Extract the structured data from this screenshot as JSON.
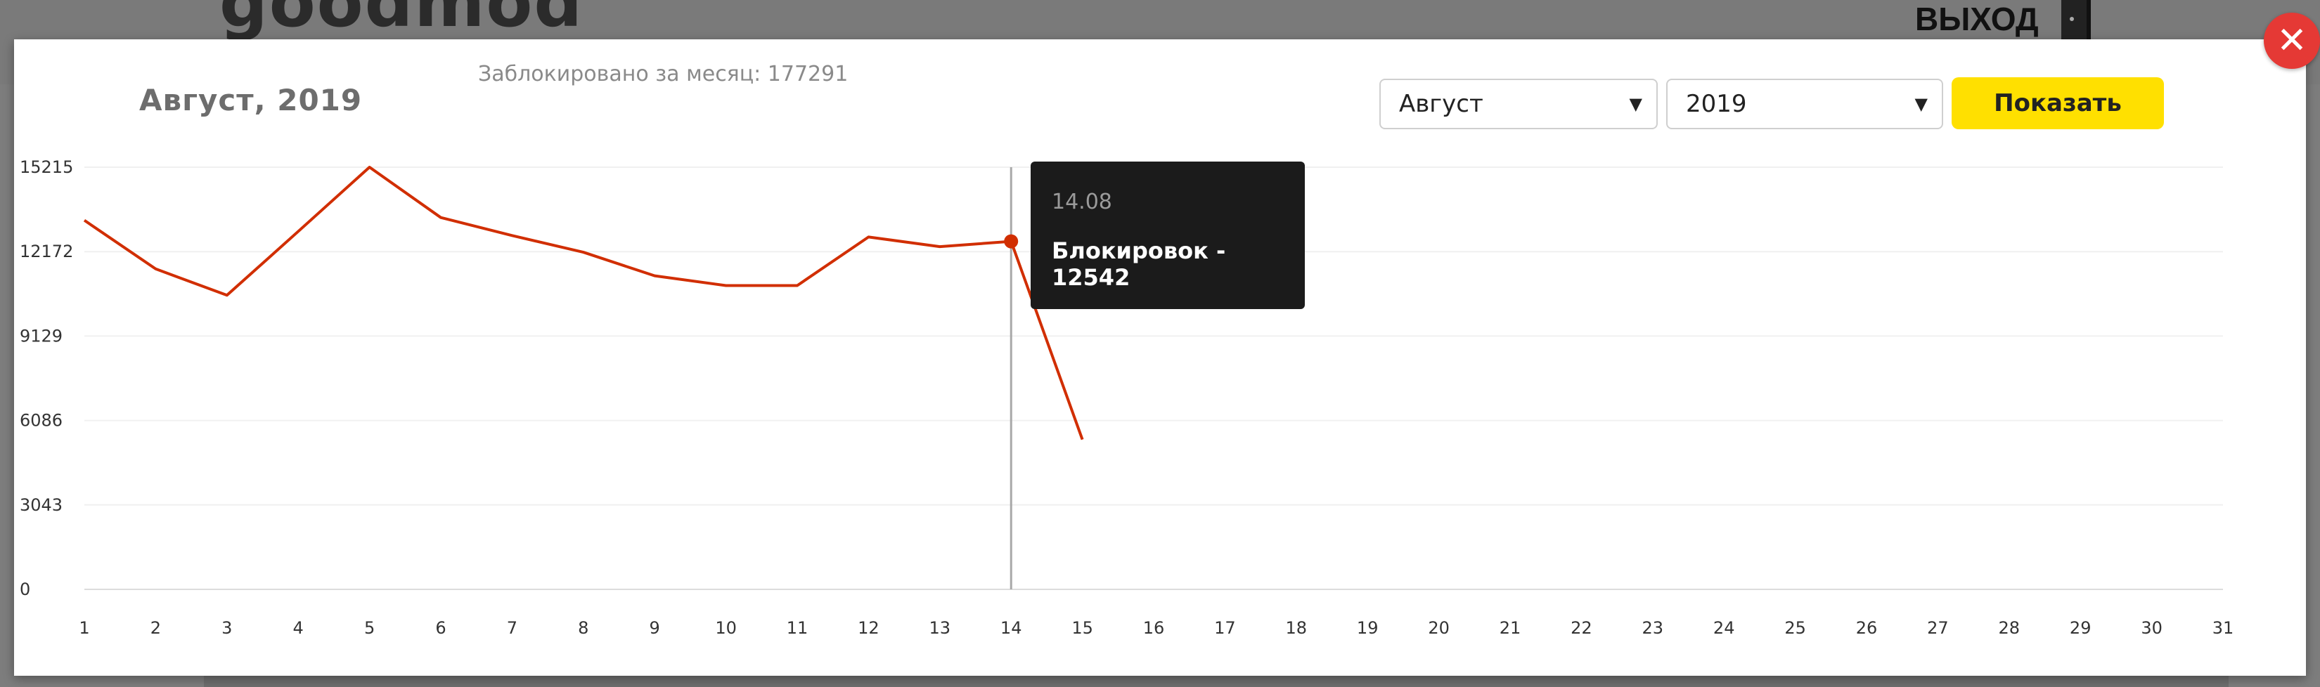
{
  "header": {
    "logo": "goodmod",
    "logout_label": "ВЫХОД"
  },
  "modal": {
    "title": "Август, 2019",
    "blocked_total": "Заблокировано за месяц: 177291",
    "month_select": {
      "value": "Август"
    },
    "year_select": {
      "value": "2019"
    },
    "show_button": "Показать",
    "close_icon": "close-icon"
  },
  "tooltip": {
    "date": "14.08",
    "text": "Блокировок - 12542"
  },
  "colors": {
    "series": "#d12e00",
    "accent_button": "#ffe000",
    "close_button": "#e53935",
    "tooltip_bg": "#1b1b1b"
  },
  "chart_data": {
    "type": "line",
    "x": [
      1,
      2,
      3,
      4,
      5,
      6,
      7,
      8,
      9,
      10,
      11,
      12,
      13,
      14,
      15
    ],
    "x_ticks": [
      "1",
      "2",
      "3",
      "4",
      "5",
      "6",
      "7",
      "8",
      "9",
      "10",
      "11",
      "12",
      "13",
      "14",
      "15",
      "16",
      "17",
      "18",
      "19",
      "20",
      "21",
      "22",
      "23",
      "24",
      "25",
      "26",
      "27",
      "28",
      "29",
      "30",
      "31"
    ],
    "y_ticks": [
      "0",
      "3043",
      "6086",
      "9129",
      "12172",
      "15215"
    ],
    "series": [
      {
        "values": [
          13300,
          11550,
          10600,
          12900,
          15215,
          13400,
          12750,
          12150,
          11300,
          10950,
          10950,
          12700,
          12350,
          12542,
          5400
        ]
      }
    ],
    "ylim": [
      0,
      15215
    ],
    "xlim": [
      1,
      31
    ],
    "grid": true,
    "highlight_x": 14
  }
}
